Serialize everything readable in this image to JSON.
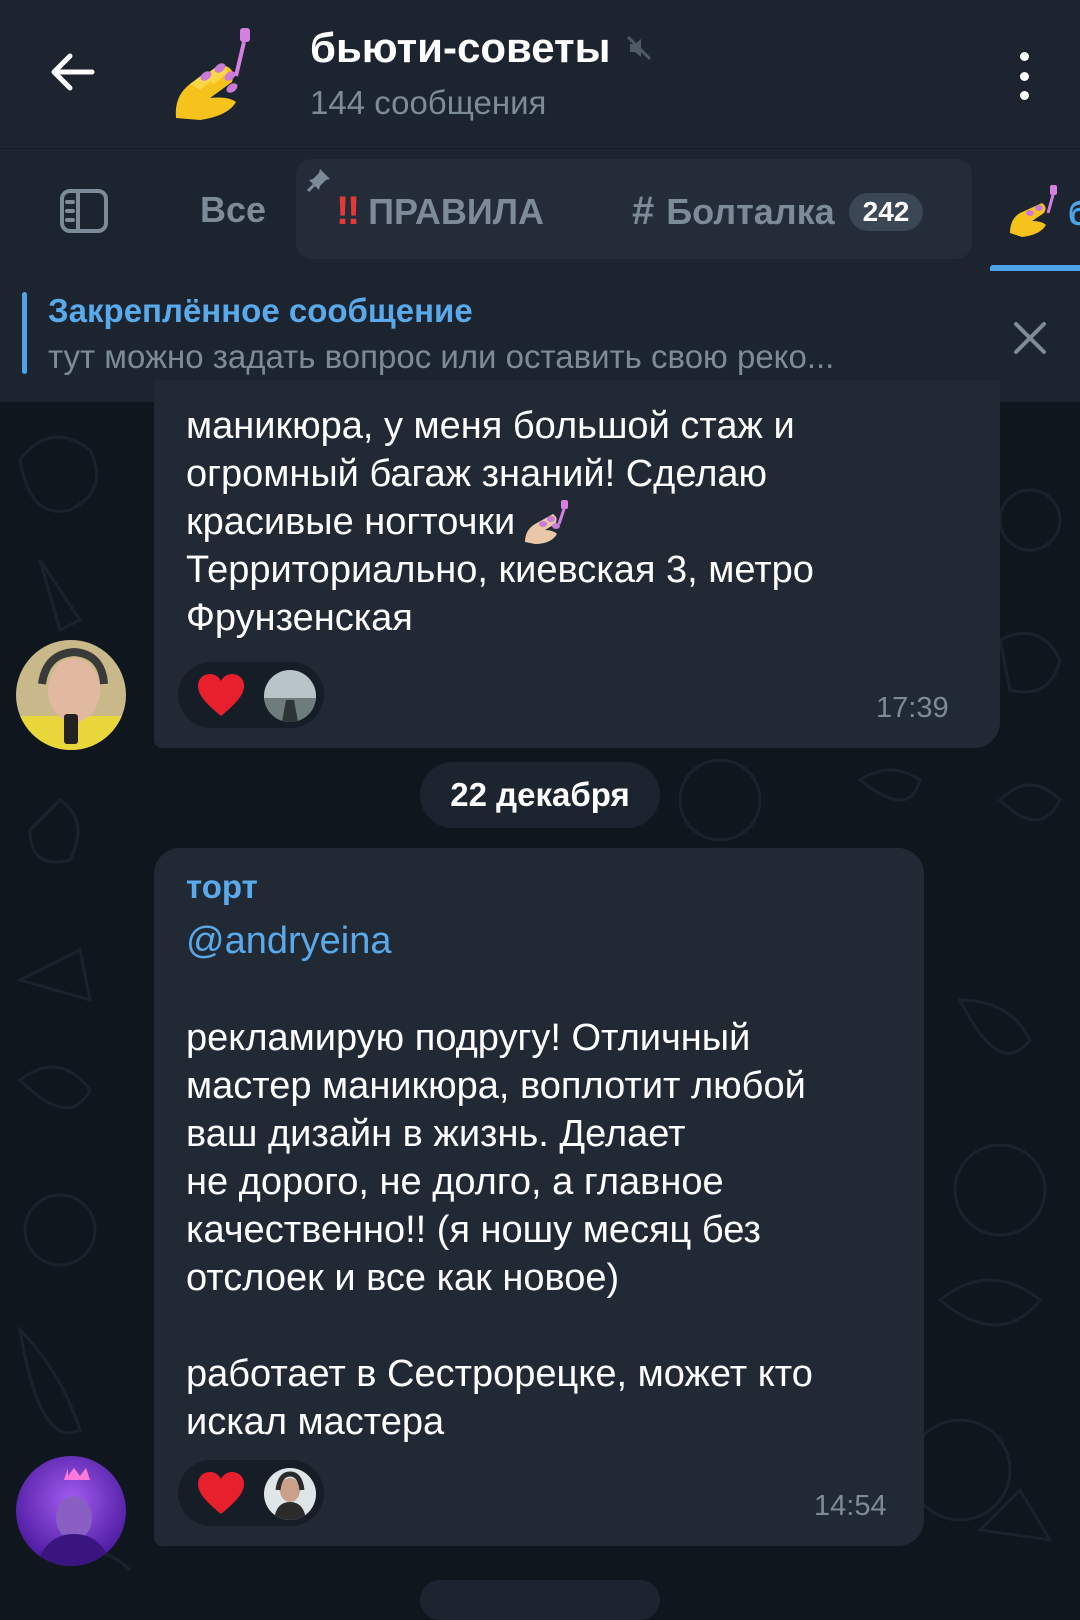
{
  "header": {
    "title": "бьюти-советы",
    "subtitle": "144 сообщения"
  },
  "tabs": {
    "all_label": "Все",
    "rules_label": "ПРАВИЛА",
    "rules_prefix": "‼",
    "chat_label": "Болталка",
    "chat_prefix": "#",
    "chat_badge": "242",
    "active_tab_icon": "nail-polish-icon"
  },
  "pinned": {
    "title": "Закреплённое сообщение",
    "text": "тут можно задать вопрос или оставить свою реко..."
  },
  "messages": [
    {
      "lines": [
        "маникюра, у меня большой стаж и",
        "огромный багаж знаний! Сделаю",
        "красивые ногточки",
        "Территориально, киевская 3, метро",
        "Фрунзенская"
      ],
      "time": "17:39",
      "reaction": "heart-icon"
    },
    {
      "sender": "торт",
      "mention": "@andryeina",
      "lines": [
        "рекламирую подругу! Отличный",
        "мастер маникюра, воплотит любой",
        "ваш дизайн в жизнь. Делает",
        "не дорого, не долго, а главное",
        "качественно!! (я ношу месяц без",
        "отслоек и все как новое)",
        "работает в Сестрорецке, может кто",
        "искал мастера"
      ],
      "time": "14:54",
      "reaction": "heart-icon"
    }
  ],
  "date_separator": "22 декабря",
  "colors": {
    "accent": "#5aa9ea",
    "bubble": "#212a34",
    "header": "#1c242f",
    "muted": "#7d8a97",
    "heart": "#e8202e"
  }
}
